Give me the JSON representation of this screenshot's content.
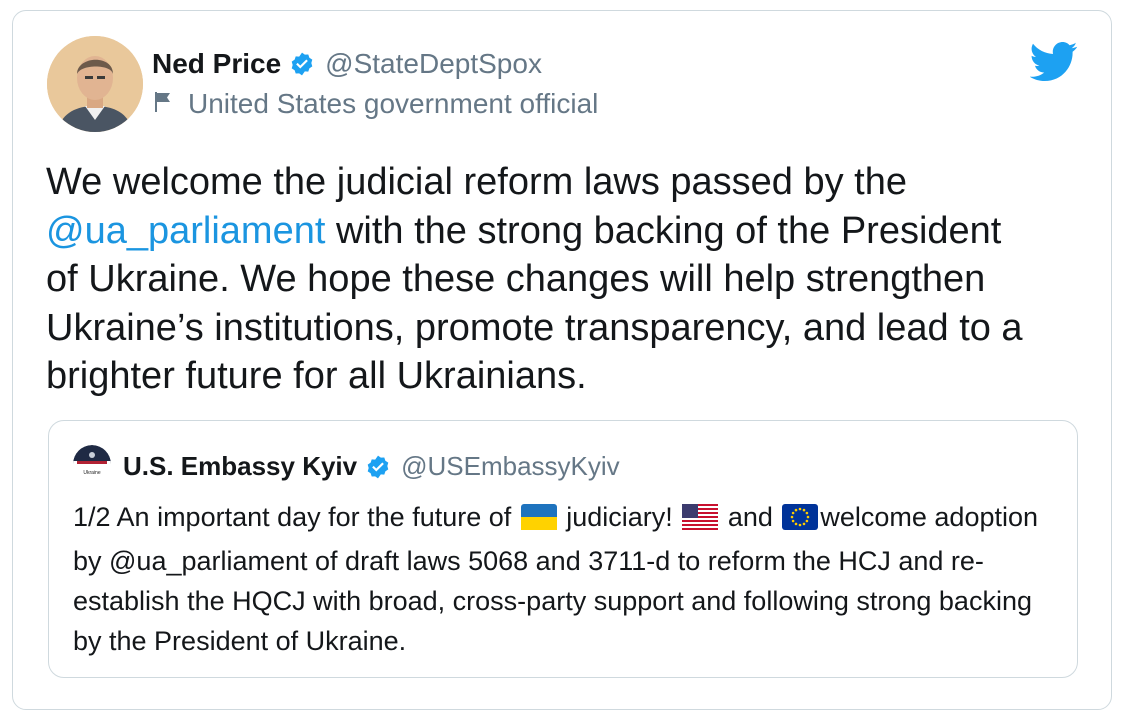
{
  "author": {
    "name": "Ned Price",
    "handle": "@StateDeptSpox",
    "label": "United States government official",
    "verified": true
  },
  "tweet": {
    "line1": "We welcome the judicial reform laws passed by the",
    "mention": "@ua_parliament",
    "line2_rest": " with the strong backing of the President",
    "rest": "of Ukraine. We hope these changes will help strengthen Ukraine’s institutions, promote transparency, and lead to a brighter future for all Ukrainians."
  },
  "quoted": {
    "avatar_text": "Ukraine",
    "name": "U.S. Embassy Kyiv",
    "handle": "@USEmbassyKyiv",
    "text_part1": "1/2 An important day for the future of ",
    "text_part2": " judiciary! ",
    "text_part3": " and ",
    "text_part4": "welcome adoption by @ua_parliament of draft laws 5068 and 3711-d to reform the HCJ and re-establish the HQCJ with broad, cross-party support and following strong backing by the President of Ukraine.",
    "flags": [
      "ukraine-flag",
      "us-flag",
      "eu-flag"
    ]
  },
  "icons": {
    "brand": "twitter-bird-icon",
    "verified": "verified-badge-icon",
    "label": "flag-icon"
  },
  "colors": {
    "link": "#1b95e0",
    "twitter_blue": "#1da1f2",
    "secondary_text": "#657786",
    "border": "#cfd9de"
  }
}
